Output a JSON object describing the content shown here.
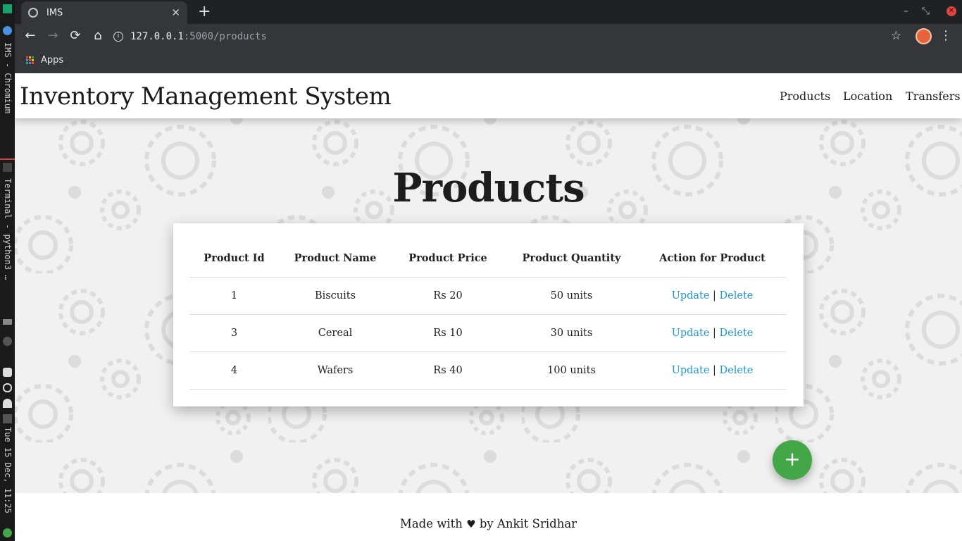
{
  "system_bar": {
    "window_label": "IMS - Chromium",
    "terminal_label": "Terminal - python3 …",
    "clock": "Tue 15 Dec, 11:25"
  },
  "browser": {
    "tab_title": "IMS",
    "url_host": "127.0.0.1",
    "url_path": ":5000/products",
    "bookmark_apps": "Apps",
    "new_tab_symbol": "+",
    "tab_close_symbol": "✕"
  },
  "site": {
    "brand": "Inventory Management System",
    "nav": [
      "Products",
      "Location",
      "Transfers"
    ]
  },
  "main": {
    "heading": "Products",
    "table": {
      "columns": [
        "Product Id",
        "Product Name",
        "Product Price",
        "Product Quantity",
        "Action for Product"
      ],
      "rows": [
        {
          "id": "1",
          "name": "Biscuits",
          "price": "Rs 20",
          "quantity": "50 units",
          "update": "Update",
          "separator": "|",
          "delete": "Delete"
        },
        {
          "id": "3",
          "name": "Cereal",
          "price": "Rs 10",
          "quantity": "30 units",
          "update": "Update",
          "separator": "|",
          "delete": "Delete"
        },
        {
          "id": "4",
          "name": "Wafers",
          "price": "Rs 40",
          "quantity": "100 units",
          "update": "Update",
          "separator": "|",
          "delete": "Delete"
        }
      ]
    },
    "add_button_symbol": "+"
  },
  "footer": {
    "prefix": "Made with",
    "heart": "♥",
    "suffix": "by Ankit Sridhar"
  },
  "colors": {
    "link": "#1e9ad6",
    "fab": "#43a647",
    "chrome_bg": "#202124",
    "pattern_bg": "#f1f1f1"
  },
  "icons": [
    "globe-icon",
    "back-icon",
    "forward-icon",
    "reload-icon",
    "home-icon",
    "info-icon",
    "star-icon",
    "avatar",
    "menu-kebab-icon",
    "apps-grid-icon",
    "plus-icon",
    "heart-icon"
  ]
}
